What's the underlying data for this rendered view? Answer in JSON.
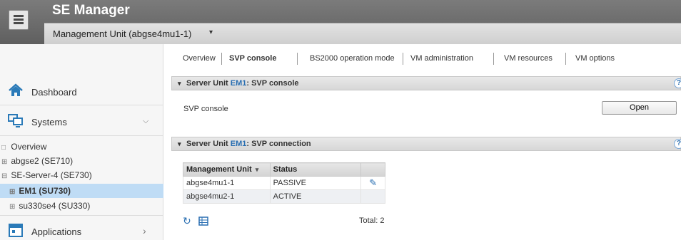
{
  "app": {
    "title": "SE Manager"
  },
  "unit_selector": {
    "label": "Management Unit (abgse4mu1-1)",
    "caret": "▾"
  },
  "sidebar": {
    "items": [
      {
        "label": "Dashboard",
        "icon": "home-icon"
      },
      {
        "label": "Systems",
        "icon": "monitors-icon",
        "chevron": "⌵"
      },
      {
        "label": "Applications",
        "icon": "calendar-icon",
        "chevron": "›"
      }
    ],
    "tree": [
      {
        "toggle": "□",
        "label": "Overview"
      },
      {
        "toggle": "⊞",
        "label": "abgse2 (SE710)"
      },
      {
        "toggle": "⊟",
        "label": "SE-Server-4 (SE730)"
      },
      {
        "toggle": "⊞",
        "label": "EM1 (SU730)"
      },
      {
        "toggle": "⊞",
        "label": "su330se4 (SU330)"
      }
    ]
  },
  "tabs": [
    {
      "label": "Overview"
    },
    {
      "label": "SVP console"
    },
    {
      "label": "BS2000 operation mode"
    },
    {
      "label": "VM administration"
    },
    {
      "label": "VM resources"
    },
    {
      "label": "VM options"
    }
  ],
  "panels": {
    "console": {
      "prefix": "Server Unit ",
      "unit": "EM1",
      "suffix": ": SVP console",
      "row_label": "SVP console",
      "button": "Open"
    },
    "connection": {
      "prefix": "Server Unit ",
      "unit": "EM1",
      "suffix": ": SVP connection",
      "columns": [
        "Management Unit",
        "Status"
      ],
      "rows": [
        {
          "unit": "abgse4mu1-1",
          "status": "PASSIVE"
        },
        {
          "unit": "abgse4mu2-1",
          "status": "ACTIVE"
        }
      ],
      "total": "Total: 2"
    }
  },
  "colors": {
    "header": "#6b6b6b",
    "accent": "#2a6fb2",
    "selection": "#bfdcf5"
  }
}
